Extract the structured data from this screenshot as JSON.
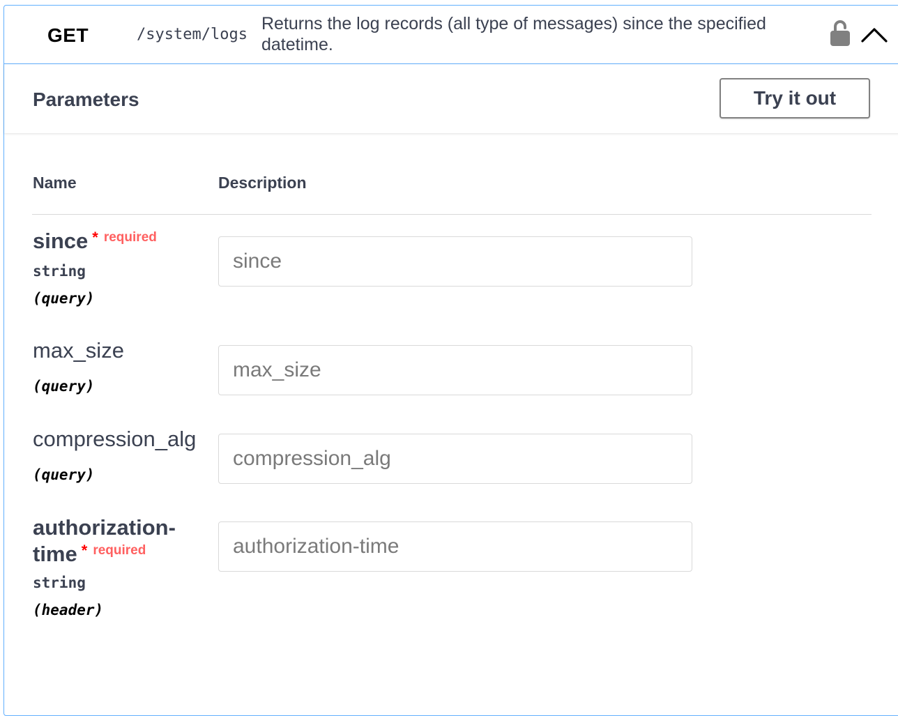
{
  "operation": {
    "method": "GET",
    "path": "/system/logs",
    "description": "Returns the log records (all type of messages) since the specified datetime.",
    "lock_icon": "lock-icon",
    "collapse_icon": "chevron-up-icon"
  },
  "parameters_section": {
    "title": "Parameters",
    "try_it_out_label": "Try it out"
  },
  "table": {
    "name_header": "Name",
    "description_header": "Description"
  },
  "parameters": [
    {
      "name": "since",
      "required": true,
      "required_label": "required",
      "star": "*",
      "type": "string",
      "in": "(query)",
      "placeholder": "since"
    },
    {
      "name": "max_size",
      "required": false,
      "type": "",
      "in": "(query)",
      "placeholder": "max_size"
    },
    {
      "name": "compression_alg",
      "required": false,
      "type": "",
      "in": "(query)",
      "placeholder": "compression_alg"
    },
    {
      "name_line1": "authorization-",
      "name_line2": "time",
      "required": true,
      "required_label": "required",
      "star": "*",
      "type": "string",
      "in": "(header)",
      "placeholder": "authorization-time"
    }
  ],
  "colors": {
    "get_border": "#61affe",
    "required": "#ff0000",
    "text": "#3b4151"
  }
}
